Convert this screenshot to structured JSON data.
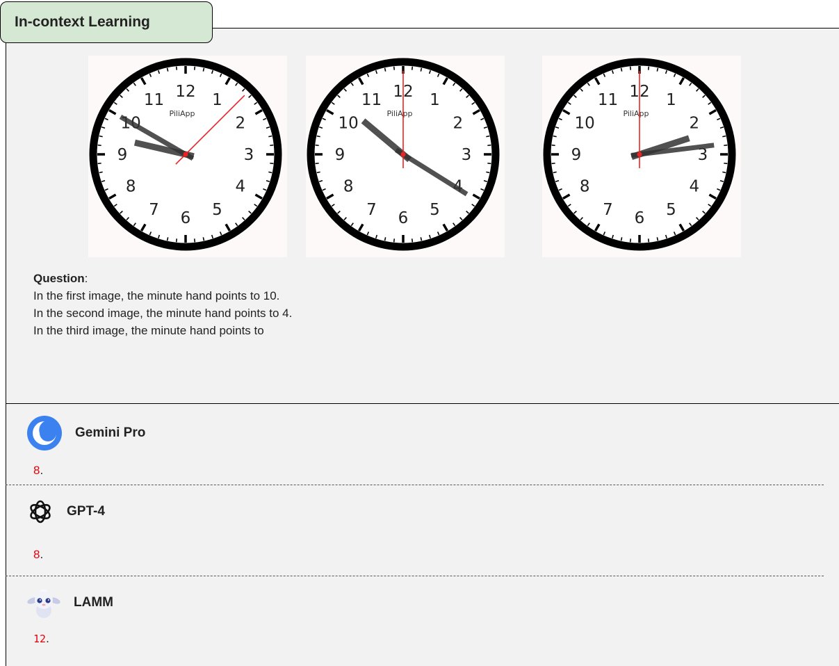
{
  "section_title": "In-context Learning",
  "clocks": [
    {
      "brand": "PiliApp",
      "hour_hand_angle": 283,
      "minute_hand_angle": 300,
      "second_hand_angle": 45
    },
    {
      "brand": "PiliApp",
      "hour_hand_angle": 310,
      "minute_hand_angle": 122,
      "second_hand_angle": 0
    },
    {
      "brand": "PiliApp",
      "hour_hand_angle": 72,
      "minute_hand_angle": 83,
      "second_hand_angle": 0
    }
  ],
  "clock_numbers": [
    "12",
    "1",
    "2",
    "3",
    "4",
    "5",
    "6",
    "7",
    "8",
    "9",
    "10",
    "11"
  ],
  "question": {
    "label": "Question",
    "lines": [
      "In the first image, the minute hand points to 10.",
      "In the second image, the minute hand points to 4.",
      "In the third image, the minute hand points to"
    ]
  },
  "answers": [
    {
      "model": "Gemini Pro",
      "icon": "gemini-icon",
      "answer": "8"
    },
    {
      "model": "GPT-4",
      "icon": "openai-icon",
      "answer": "8"
    },
    {
      "model": "LAMM",
      "icon": "lamm-avatar-icon",
      "answer": "12"
    }
  ],
  "colors": {
    "tab_bg": "#d5e8d4",
    "panel_bg": "#f2f2f2",
    "answer": "#e8000b"
  }
}
